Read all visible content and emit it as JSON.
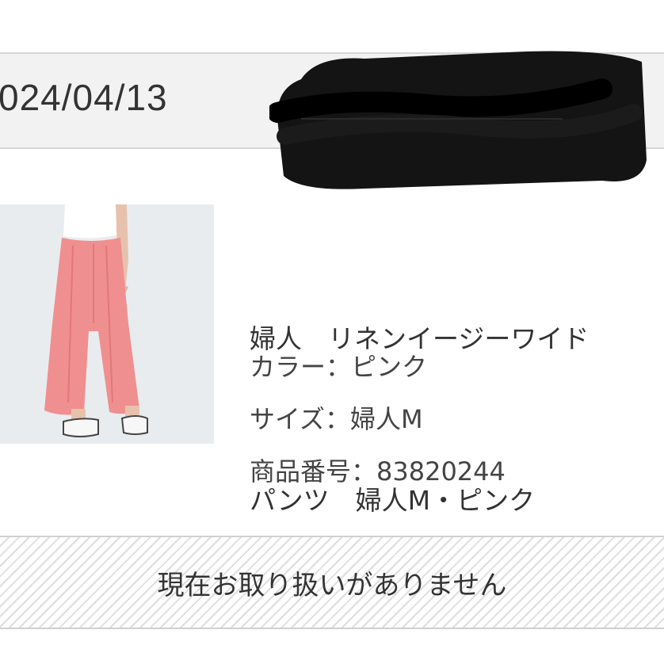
{
  "order": {
    "date": "024/04/13"
  },
  "product": {
    "title_line1": "婦人　リネンイージーワイド",
    "title_line2": "パンツ　婦人M・ピンク",
    "color_line": "カラー：ピンク",
    "size_line": "サイズ：婦人M",
    "code_line": "商品番号：83820244",
    "image_icon": "pink-wide-pants-photo"
  },
  "notice": {
    "text": "現在お取り扱いがありません"
  },
  "colors": {
    "pants": "#f08f8f",
    "bar_background": "#f2f2f2",
    "redaction": "#141414"
  }
}
